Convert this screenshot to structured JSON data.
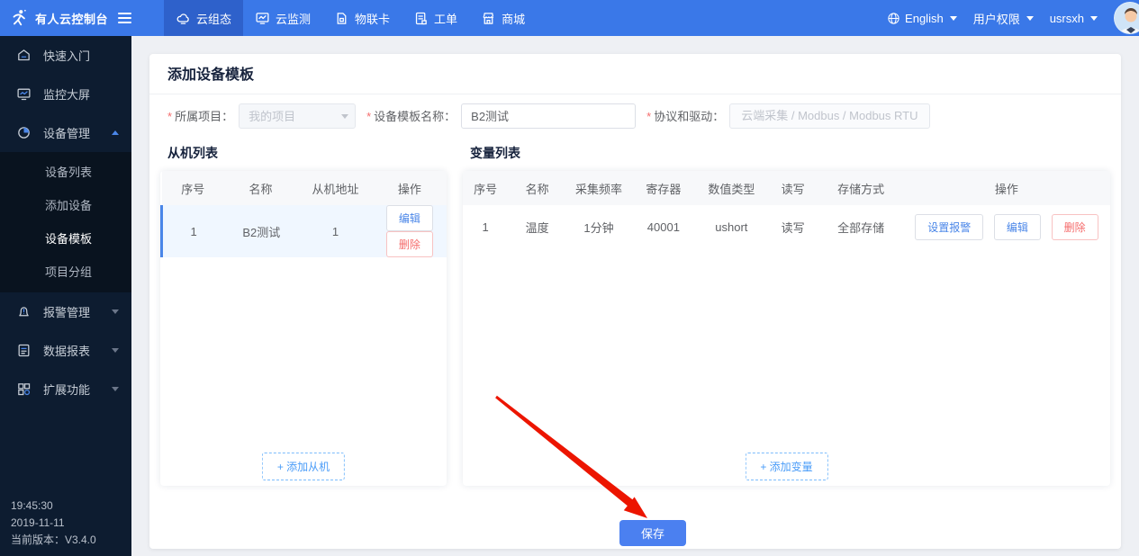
{
  "topbar": {
    "logo_title": "有人云控制台",
    "nav": [
      {
        "label": "云组态",
        "active": true
      },
      {
        "label": "云监测",
        "active": false
      },
      {
        "label": "物联卡",
        "active": false
      },
      {
        "label": "工单",
        "active": false
      },
      {
        "label": "商城",
        "active": false
      }
    ],
    "language": "English",
    "permission_menu": "用户权限",
    "username": "usrsxh"
  },
  "sidebar": {
    "items": [
      {
        "label": "快速入门"
      },
      {
        "label": "监控大屏"
      },
      {
        "label": "设备管理"
      },
      {
        "label": "报警管理"
      },
      {
        "label": "数据报表"
      },
      {
        "label": "扩展功能"
      }
    ],
    "device_children": [
      {
        "label": "设备列表"
      },
      {
        "label": "添加设备"
      },
      {
        "label": "设备模板"
      },
      {
        "label": "项目分组"
      }
    ],
    "footer": {
      "time": "19:45:30",
      "date": "2019-11-11",
      "version": "当前版本：V3.4.0"
    }
  },
  "page": {
    "title": "添加设备模板",
    "form": {
      "project_label": "所属项目：",
      "project_value": "我的项目",
      "template_name_label": "设备模板名称：",
      "template_name_value": "B2测试",
      "protocol_label": "协议和驱动：",
      "protocol_value": "云端采集  /  Modbus  /  Modbus RTU"
    },
    "slave": {
      "title": "从机列表",
      "headers": [
        "序号",
        "名称",
        "从机地址",
        "操作"
      ],
      "rows": [
        {
          "seq": "1",
          "name": "B2测试",
          "addr": "1"
        }
      ],
      "edit_label": "编辑",
      "delete_label": "删除",
      "add_label": "+ 添加从机"
    },
    "variables": {
      "title": "变量列表",
      "headers": [
        "序号",
        "名称",
        "采集频率",
        "寄存器",
        "数值类型",
        "读写",
        "存储方式",
        "操作"
      ],
      "rows": [
        {
          "seq": "1",
          "name": "温度",
          "freq": "1分钟",
          "register": "40001",
          "dtype": "ushort",
          "rw": "读写",
          "storage": "全部存储"
        }
      ],
      "alarm_label": "设置报警",
      "edit_label": "编辑",
      "delete_label": "删除",
      "add_label": "+ 添加变量"
    },
    "save_label": "保存"
  },
  "colors": {
    "topbar": "#3a78e8",
    "topbar_active": "#2e61cb",
    "sidebar": "#0d1c30",
    "accent_blue": "#4a86e8",
    "danger_red": "#f56c6c",
    "save_blue": "#4b80f0",
    "arrow_red": "#ec1500",
    "selected_row": "#f0f7ff"
  }
}
